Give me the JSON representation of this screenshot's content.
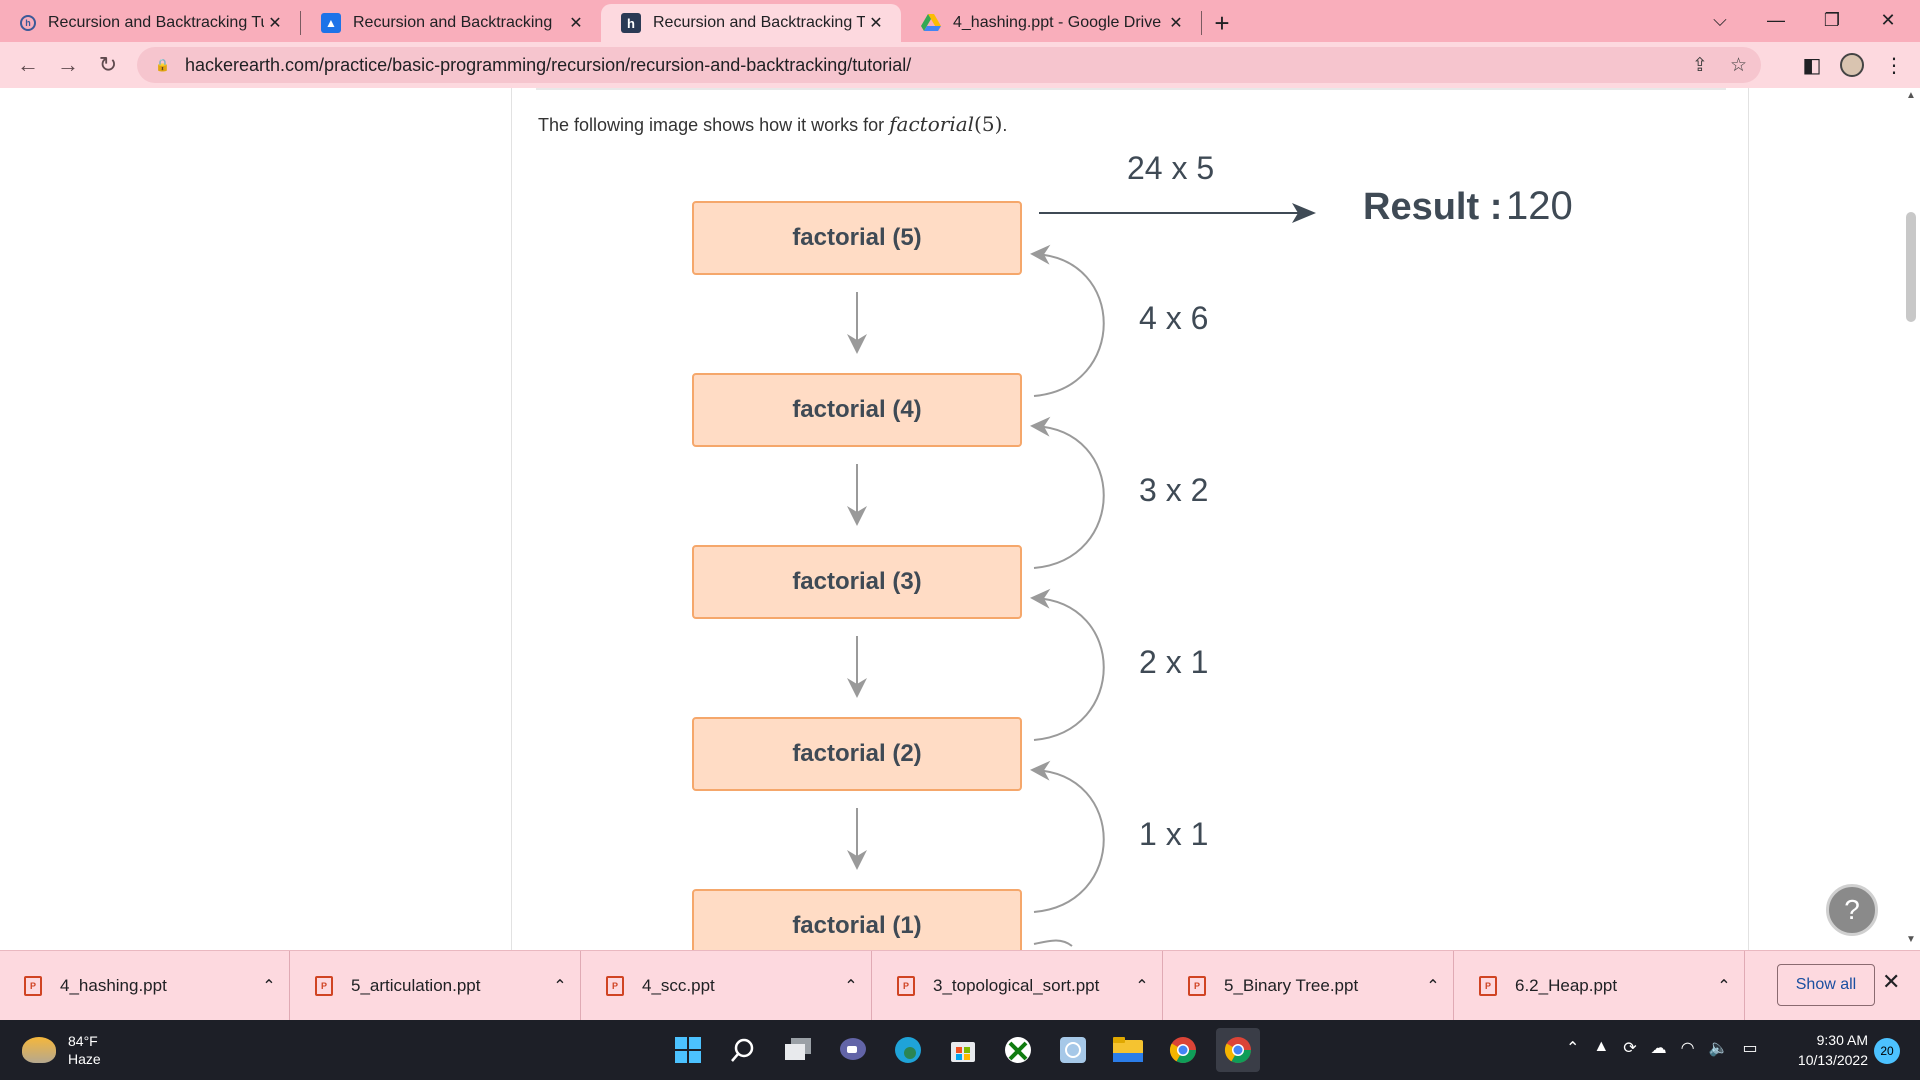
{
  "browser": {
    "tabs": [
      {
        "title": "Recursion and Backtracking Tuto",
        "icon": "hackerearth-icon",
        "active": false
      },
      {
        "title": "Recursion and Backtracking",
        "icon": "classroom-icon",
        "active": false
      },
      {
        "title": "Recursion and Backtracking Tuto",
        "icon": "hackerearth-h-icon",
        "active": true
      },
      {
        "title": "4_hashing.ppt - Google Drive",
        "icon": "drive-icon",
        "active": false
      }
    ],
    "url": "hackerearth.com/practice/basic-programming/recursion/recursion-and-backtracking/tutorial/"
  },
  "article": {
    "intro_text": "The following image shows how it works for",
    "intro_math_fn": "factorial",
    "intro_math_arg": "(5)",
    "intro_end": "."
  },
  "diagram": {
    "boxes": [
      {
        "label": "factorial (5)"
      },
      {
        "label": "factorial (4)"
      },
      {
        "label": "factorial (3)"
      },
      {
        "label": "factorial (2)"
      },
      {
        "label": "factorial (1)"
      }
    ],
    "multiplications": [
      "24 x 5",
      "4 x 6",
      "3 x 2",
      "2 x 1",
      "1 x 1"
    ],
    "result_label": "Result :",
    "result_value": "120",
    "colors": {
      "box_fill": "#ffdcc5",
      "box_border": "#f5a76b",
      "text": "#3f4a55",
      "arrow": "#9a9a9a"
    }
  },
  "help_button": {
    "label": "?"
  },
  "downloads": {
    "items": [
      "4_hashing.ppt",
      "5_articulation.ppt",
      "4_scc.ppt",
      "3_topological_sort.ppt",
      "5_Binary Tree.ppt",
      "6.2_Heap.ppt"
    ],
    "show_all": "Show all"
  },
  "taskbar": {
    "temperature": "84°F",
    "condition": "Haze",
    "time": "9:30 AM",
    "date": "10/13/2022",
    "notifications": "20"
  }
}
